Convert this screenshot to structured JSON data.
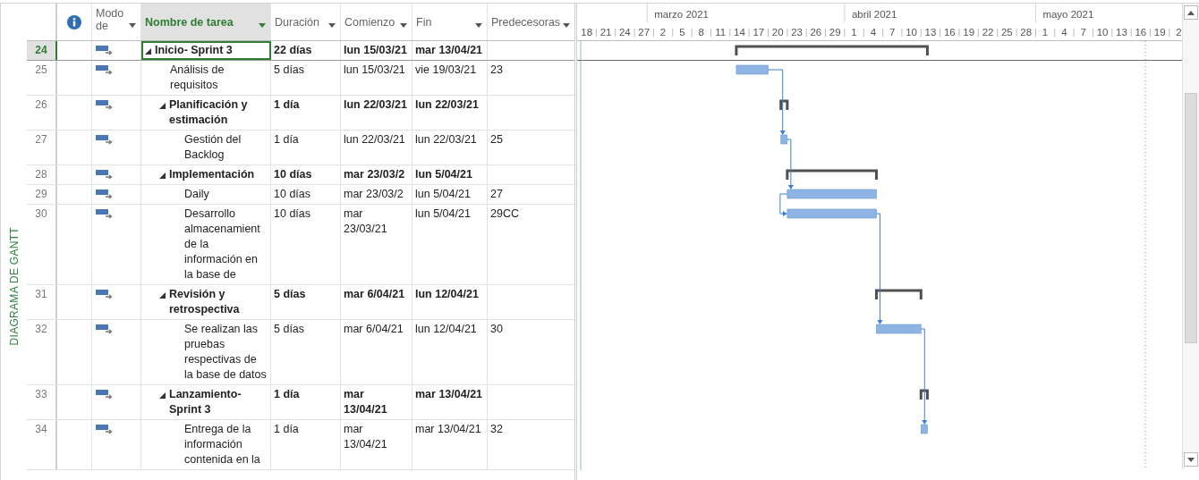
{
  "side_label": "DIAGRAMA DE GANTT",
  "columns": [
    {
      "label": "Modo de",
      "selected": false
    },
    {
      "label": "Nombre de tarea",
      "selected": true
    },
    {
      "label": "Duración",
      "selected": false
    },
    {
      "label": "Comienzo",
      "selected": false
    },
    {
      "label": "Fin",
      "selected": false
    },
    {
      "label": "Predecesoras",
      "selected": false
    }
  ],
  "timescale": {
    "months": [
      "marzo 2021",
      "abril 2021",
      "mayo 2021"
    ],
    "days": [
      "18",
      "21",
      "24",
      "27",
      "2",
      "5",
      "8",
      "11",
      "14",
      "17",
      "20",
      "23",
      "26",
      "29",
      "1",
      "4",
      "7",
      "10",
      "13",
      "16",
      "19",
      "22",
      "25",
      "28",
      "1",
      "4",
      "7",
      "10",
      "13",
      "16",
      "19",
      "2"
    ]
  },
  "tasks": [
    {
      "id": "24",
      "kind": "summary",
      "expanded": true,
      "selected": true,
      "name": "Inicio- Sprint 3",
      "duration": "22 días",
      "start": "lun 15/03/21",
      "finish": "mar 13/04/21",
      "children": [
        {
          "id": "25",
          "kind": "task",
          "selected": false,
          "name": "Análisis de requisitos",
          "duration": "5 días",
          "start": "lun 15/03/21",
          "finish": "vie 19/03/21",
          "predecessors": "23"
        },
        {
          "id": "26",
          "kind": "summary",
          "expanded": true,
          "selected": false,
          "name": "Planificación y estimación",
          "duration": "1 día",
          "start": "lun 22/03/21",
          "finish": "lun 22/03/21",
          "children": [
            {
              "id": "27",
              "kind": "task",
              "selected": false,
              "name": "Gestión del Backlog",
              "duration": "1 día",
              "start": "lun 22/03/21",
              "finish": "lun 22/03/21",
              "predecessors": "25"
            }
          ]
        },
        {
          "id": "28",
          "kind": "summary",
          "expanded": true,
          "selected": false,
          "name": "Implementación",
          "duration": "10 días",
          "start": "mar 23/03/2",
          "finish": "lun 5/04/21",
          "children": [
            {
              "id": "29",
              "kind": "task",
              "selected": false,
              "name": "Daily",
              "duration": "10 días",
              "start": "mar 23/03/2",
              "finish": "lun 5/04/21",
              "predecessors": "27"
            },
            {
              "id": "30",
              "kind": "task",
              "selected": false,
              "name": "Desarrollo almacenamient de la información en la base de",
              "duration": "10 días",
              "start": "mar 23/03/21",
              "finish": "lun 5/04/21",
              "predecessors": "29CC"
            }
          ]
        },
        {
          "id": "31",
          "kind": "summary",
          "expanded": true,
          "selected": false,
          "name": "Revisión y retrospectiva",
          "duration": "5 días",
          "start": "mar 6/04/21",
          "finish": "lun 12/04/21",
          "children": [
            {
              "id": "32",
              "kind": "task",
              "selected": false,
              "name": "Se realizan las pruebas respectivas de la base de datos",
              "duration": "5 días",
              "start": "mar 6/04/21",
              "finish": "lun 12/04/21",
              "predecessors": "30"
            }
          ]
        },
        {
          "id": "33",
          "kind": "summary",
          "expanded": true,
          "selected": false,
          "name": "Lanzamiento- Sprint 3",
          "duration": "1 día",
          "start": "mar 13/04/21",
          "finish": "mar 13/04/21",
          "children": [
            {
              "id": "34",
              "kind": "task",
              "selected": false,
              "name": "Entrega de la información contenida en la",
              "duration": "1 día",
              "start": "mar 13/04/21",
              "finish": "mar 13/04/21",
              "predecessors": "32"
            }
          ]
        }
      ]
    }
  ]
}
